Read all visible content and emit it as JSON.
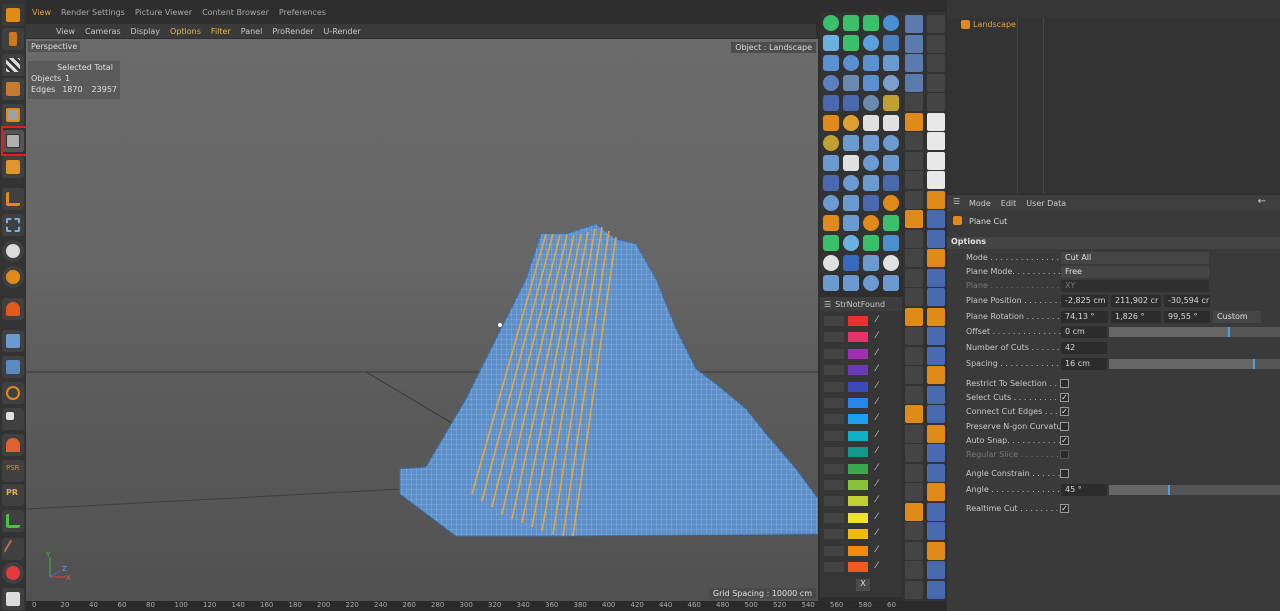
{
  "top_tabs": [
    "View",
    "Render Settings",
    "Picture Viewer",
    "Content Browser",
    "Preferences"
  ],
  "viewport_menu": [
    "View",
    "Cameras",
    "Display",
    "Options",
    "Filter",
    "Panel",
    "ProRender",
    "U-Render"
  ],
  "viewport": {
    "label": "Perspective",
    "object_label": "Object : Landscape",
    "grid_spacing": "Grid Spacing : 10000 cm",
    "stats": {
      "header": "Selected Total",
      "rows": [
        {
          "label": "Objects",
          "selected": "1",
          "total": ""
        },
        {
          "label": "Edges",
          "selected": "1870",
          "total": "23957"
        }
      ]
    },
    "axis_labels": {
      "y": "Y",
      "z": "Z",
      "x": "X"
    }
  },
  "color_panel": {
    "header": "StrNotFound",
    "close_label": "X",
    "swatches": [
      "#f03030",
      "#e8306a",
      "#a030b0",
      "#6a3ab8",
      "#3a4ab8",
      "#2a86e8",
      "#1aa0f0",
      "#10b0c8",
      "#10988a",
      "#3aa84a",
      "#8abf3a",
      "#c0d030",
      "#f0e030",
      "#f0b810",
      "#f08a10",
      "#f05a1a"
    ]
  },
  "object_manager": {
    "objects": [
      {
        "name": "Landscape"
      }
    ]
  },
  "attributes": {
    "menu": [
      "Mode",
      "Edit",
      "User Data"
    ],
    "title": "Plane Cut",
    "section": "Options",
    "mode": {
      "label": "Mode . . . . . . . . . . . . . . .",
      "value": "Cut All"
    },
    "plane_mode": {
      "label": "Plane Mode. . . . . . . . . . .",
      "value": "Free"
    },
    "plane": {
      "label": "Plane . . . . . . . . . . . . . . .",
      "value": "XY"
    },
    "plane_position": {
      "label": "Plane Position . . . . . . . .",
      "values": [
        "-2,825 cm",
        "211,902 cr",
        "-30,594 cr"
      ]
    },
    "plane_rotation": {
      "label": "Plane Rotation . . . . . . . .",
      "values": [
        "74,13 °",
        "1,826 °",
        "99,55 °"
      ],
      "dropdown": "Custom"
    },
    "offset": {
      "label": "Offset . . . . . . . . . . . . . .",
      "value": "0 cm",
      "slider": 0.7
    },
    "number_of_cuts": {
      "label": "Number of Cuts . . . . . . .",
      "value": "42"
    },
    "spacing": {
      "label": "Spacing . . . . . . . . . . . . .",
      "value": "16 cm",
      "slider": 0.85
    },
    "checks": [
      {
        "label": "Restrict To Selection . . . .",
        "checked": false,
        "dim": false
      },
      {
        "label": "Select Cuts . . . . . . . . . .",
        "checked": true,
        "dim": false
      },
      {
        "label": "Connect Cut Edges . . . . .",
        "checked": true,
        "dim": false
      },
      {
        "label": "Preserve N-gon Curvature",
        "checked": false,
        "dim": false
      },
      {
        "label": "Auto Snap. . . . . . . . . . .",
        "checked": true,
        "dim": false
      },
      {
        "label": "Regular Slice . . . . . . . .",
        "checked": false,
        "dim": true
      }
    ],
    "angle_constrain": {
      "label": "Angle Constrain . . . . . . .",
      "checked": false
    },
    "angle": {
      "label": "Angle . . . . . . . . . . . . . .",
      "value": "45 °",
      "slider": 0.35
    },
    "realtime_cut": {
      "label": "Realtime Cut . . . . . . . . .",
      "checked": true
    }
  },
  "timeline": [
    "0",
    "20",
    "40",
    "60",
    "80",
    "100",
    "120",
    "140",
    "160",
    "180",
    "200",
    "220",
    "240",
    "260",
    "280",
    "300",
    "320",
    "340",
    "360",
    "380",
    "400",
    "420",
    "440",
    "460",
    "480",
    "500",
    "520",
    "540",
    "560",
    "580",
    "60"
  ]
}
